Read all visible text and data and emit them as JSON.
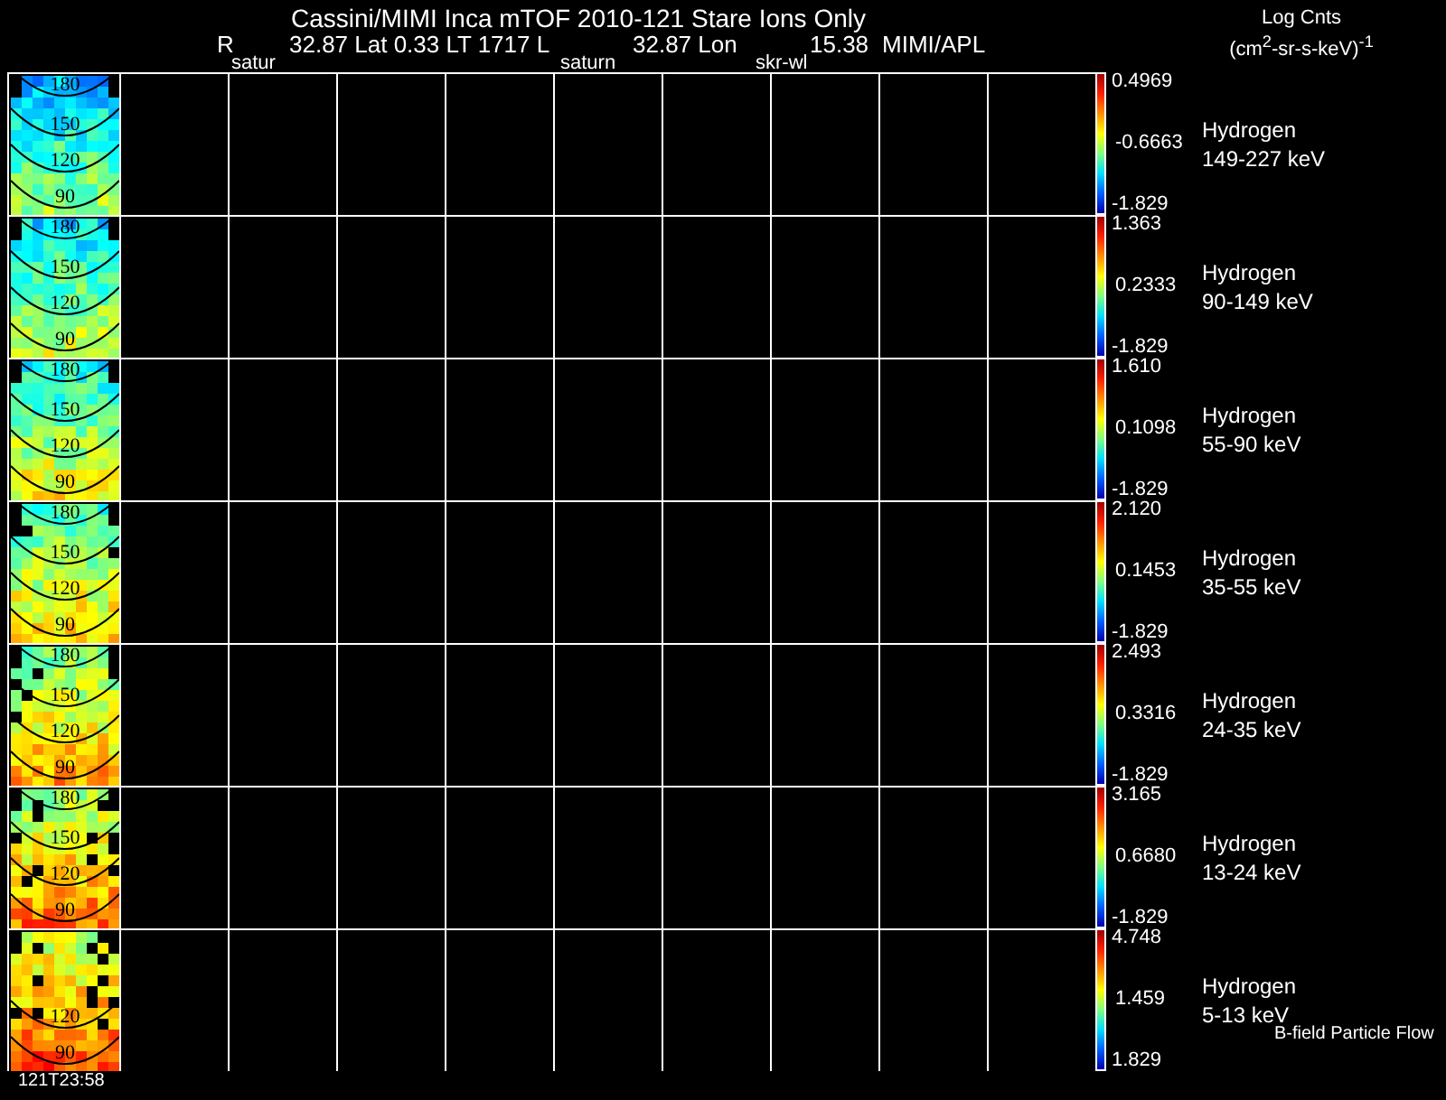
{
  "title": "Cassini/MIMI Inca mTOF  2010-121   Stare   Ions Only",
  "ephemeris": [
    "R",
    "32.87 Lat 0.33 LT 1717 L",
    "32.87 Lon",
    "15.38",
    "MIMI/APL"
  ],
  "target_labels": [
    "satur",
    "saturn",
    "skr-wl"
  ],
  "units": {
    "title": "Log Cnts",
    "unit": "(cm$^{2}$-sr-s-keV)$^{-1}$"
  },
  "panels": [
    {
      "species": "Hydrogen",
      "energy": "149-227 keV",
      "max": "0.4969",
      "mid": "-0.6663",
      "min": "-1.829",
      "contours": [
        "180",
        "150",
        "120",
        "90"
      ]
    },
    {
      "species": "Hydrogen",
      "energy": "90-149 keV",
      "max": "1.363",
      "mid": "0.2333",
      "min": "-1.829",
      "contours": [
        "180",
        "150",
        "120",
        "90"
      ]
    },
    {
      "species": "Hydrogen",
      "energy": "55-90 keV",
      "max": "1.610",
      "mid": "0.1098",
      "min": "-1.829",
      "contours": [
        "180",
        "150",
        "120",
        "90"
      ]
    },
    {
      "species": "Hydrogen",
      "energy": "35-55 keV",
      "max": "2.120",
      "mid": "0.1453",
      "min": "-1.829",
      "contours": [
        "180",
        "150",
        "120",
        "90"
      ]
    },
    {
      "species": "Hydrogen",
      "energy": "24-35 keV",
      "max": "2.493",
      "mid": "0.3316",
      "min": "-1.829",
      "contours": [
        "180",
        "150",
        "120",
        "90"
      ]
    },
    {
      "species": "Hydrogen",
      "energy": "13-24 keV",
      "max": "3.165",
      "mid": "0.6680",
      "min": "-1.829",
      "contours": [
        "180",
        "150",
        "120",
        "90"
      ]
    },
    {
      "species": "Hydrogen",
      "energy": "5-13 keV",
      "max": "4.748",
      "mid": "1.459",
      "min": "1.829",
      "contours": [
        "120",
        "90"
      ]
    }
  ],
  "legend_note": "B-field Particle Flow",
  "time": "121T23:58"
}
